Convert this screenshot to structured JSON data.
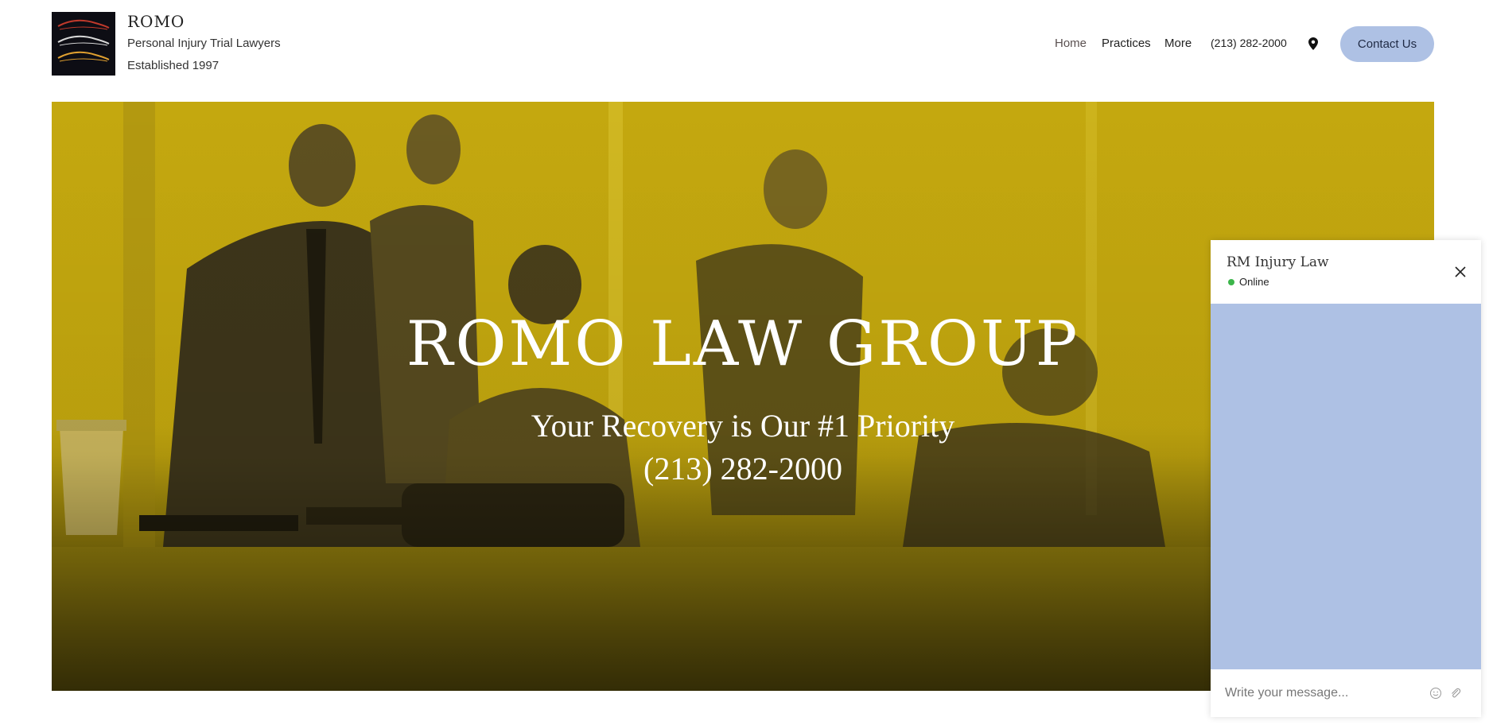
{
  "brand": {
    "name": "ROMO",
    "subtitle": "Personal Injury Trial Lawyers",
    "established": "Established 1997"
  },
  "nav": {
    "items": [
      {
        "label": "Home"
      },
      {
        "label": "Practices"
      },
      {
        "label": "More"
      }
    ],
    "phone": "(213) 282-2000",
    "contact_label": "Contact Us"
  },
  "hero": {
    "title": "ROMO LAW GROUP",
    "tagline": "Your Recovery is Our #1 Priority",
    "phone": "(213) 282-2000"
  },
  "chat": {
    "title": "RM Injury Law",
    "status": "Online",
    "placeholder": "Write your message..."
  },
  "colors": {
    "accent": "#aec1e4",
    "hero_tint": "#c4a80f",
    "online": "#3cb54a"
  },
  "icons": [
    "location-pin-icon",
    "close-icon",
    "emoji-icon",
    "attachment-icon"
  ]
}
